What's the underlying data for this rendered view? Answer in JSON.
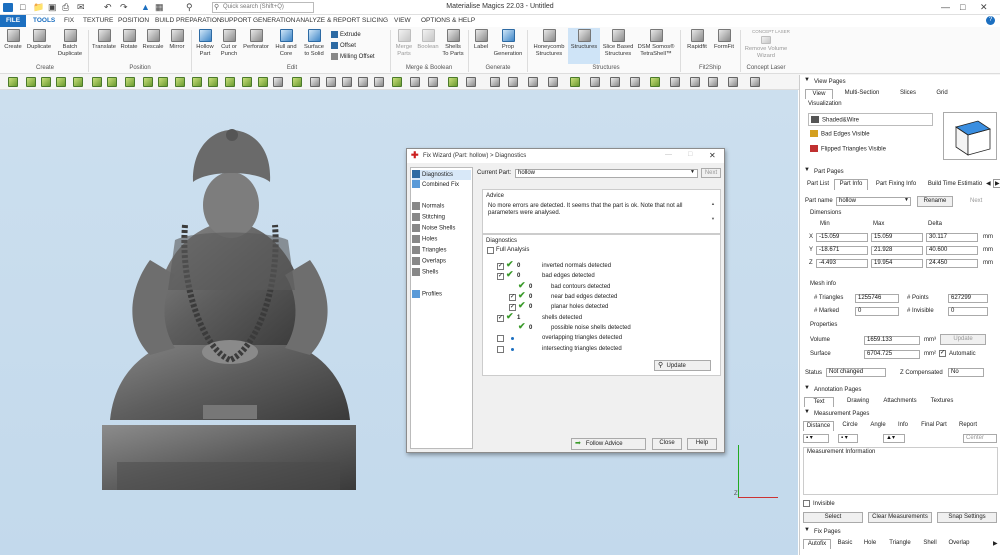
{
  "app": {
    "title": "Materialise Magics 22.03 - Untitled"
  },
  "search": {
    "placeholder": "Quick search (Shift+Q)"
  },
  "menu": [
    "FILE",
    "TOOLS",
    "FIX",
    "TEXTURE",
    "POSITION",
    "BUILD PREPARATION",
    "SUPPORT GENERATION",
    "ANALYZE & REPORT",
    "SLICING",
    "VIEW",
    "OPTIONS & HELP"
  ],
  "ribbon": {
    "create": {
      "b1": "Create",
      "b2": "Duplicate",
      "b3a": "Batch",
      "b3b": "Duplicate",
      "group": "Create"
    },
    "position": {
      "b1": "Translate",
      "b2": "Rotate",
      "b3": "Rescale",
      "b4": "Mirror",
      "group": "Position"
    },
    "edit": {
      "b1a": "Hollow",
      "b1b": "Part",
      "b2a": "Cut or",
      "b2b": "Punch",
      "b3": "Perforator",
      "b4a": "Hull and",
      "b4b": "Core",
      "b5a": "Surface",
      "b5b": "to Solid",
      "extrude": "Extrude",
      "offset": "Offset",
      "milling": "Milling Offset",
      "group": "Edit"
    },
    "merge": {
      "b1a": "Merge",
      "b1b": "Parts",
      "b2a": "Boolean",
      "b3a": "Shells",
      "b3b": "To Parts",
      "group": "Merge & Boolean"
    },
    "generate": {
      "b1": "Label",
      "b2a": "Prop",
      "b2b": "Generation",
      "group": "Generate"
    },
    "structures": {
      "b1a": "Honeycomb",
      "b1b": "Structures",
      "b2": "Structures",
      "b3a": "Slice Based",
      "b3b": "Structures",
      "b4a": "DSM Somos®",
      "b4b": "TetraShell™",
      "group": "Structures"
    },
    "fit": {
      "b1": "Rapidfit",
      "b2": "FormFit",
      "group": "Fit2Ship"
    },
    "laser": {
      "b1a": "Remove Volume",
      "b1b": "Wizard",
      "group": "Concept Laser",
      "top": "CONCEPT LASER"
    }
  },
  "right": {
    "view_pages": "View Pages",
    "view_tabs": [
      "View",
      "Multi-Section",
      "Slices",
      "Grid"
    ],
    "visualization": "Visualization",
    "vis_items": [
      "Shaded&Wire",
      "Bad Edges Visible",
      "Flipped Triangles Visible"
    ],
    "part_pages": "Part Pages",
    "part_tabs": [
      "Part List",
      "Part Info",
      "Part Fixing Info",
      "Build Time Estimatio"
    ],
    "part_name_label": "Part name",
    "part_name": "hollow",
    "rename": "Rename",
    "next": "Next",
    "dimensions": "Dimensions",
    "dim_headers": [
      "Min",
      "Max",
      "Delta"
    ],
    "dims": [
      {
        "axis": "X",
        "min": "-15.059",
        "max": "15.059",
        "delta": "30.117",
        "unit": "mm"
      },
      {
        "axis": "Y",
        "min": "-18.671",
        "max": "21.928",
        "delta": "40.600",
        "unit": "mm"
      },
      {
        "axis": "Z",
        "min": "-4.493",
        "max": "19.954",
        "delta": "24.450",
        "unit": "mm"
      }
    ],
    "mesh_info": "Mesh info",
    "triangles_label": "# Triangles",
    "triangles": "1255746",
    "points_label": "# Points",
    "points": "627299",
    "marked_label": "# Marked",
    "marked": "0",
    "invisible_label": "# Invisible",
    "invisible": "0",
    "properties": "Properties",
    "volume_label": "Volume",
    "volume": "1659.133",
    "volume_unit": "mm³",
    "update": "Update",
    "surface_label": "Surface",
    "surface": "6704.725",
    "surface_unit": "mm²",
    "automatic": "Automatic",
    "status_label": "Status",
    "status": "Not changed",
    "zcomp_label": "Z Compensated",
    "zcomp": "No",
    "annotation_pages": "Annotation Pages",
    "annotation_tabs": [
      "Text",
      "Drawing",
      "Attachments",
      "Textures"
    ],
    "measurement_pages": "Measurement Pages",
    "measure_tabs": [
      "Distance",
      "Circle",
      "Angle",
      "Info",
      "Final Part",
      "Report"
    ],
    "center": "Center",
    "measurement_info": "Measurement Information",
    "invisible_cb": "Invisible",
    "select": "Select",
    "clear": "Clear Measurements",
    "snap": "Snap Settings",
    "fix_pages": "Fix Pages",
    "fix_tabs": [
      "Autofix",
      "Basic",
      "Hole",
      "Triangle",
      "Shell",
      "Overlap"
    ]
  },
  "dialog": {
    "title": "Fix Wizard (Part: hollow) > Diagnostics",
    "nav_top": [
      "Diagnostics",
      "Combined Fix"
    ],
    "nav_mid": [
      "Normals",
      "Stitching",
      "Noise Shells",
      "Holes",
      "Triangles",
      "Overlaps",
      "Shells"
    ],
    "nav_bot": [
      "Profiles"
    ],
    "current_part_label": "Current Part:",
    "current_part": "hollow",
    "next": "Next",
    "advice_title": "Advice",
    "advice_text": "No more errors are detected. It seems that the part is ok. Note that not all parameters were analysed.",
    "diag_title": "Diagnostics",
    "full_analysis": "Full Analysis",
    "rows": [
      {
        "label": "inverted normals detected",
        "count": "0",
        "indent": 0,
        "check": true,
        "box": true
      },
      {
        "label": "bad edges detected",
        "count": "0",
        "indent": 0,
        "check": true,
        "box": true
      },
      {
        "label": "bad contours detected",
        "count": "0",
        "indent": 1,
        "check": true,
        "box": false
      },
      {
        "label": "near bad edges detected",
        "count": "0",
        "indent": 1,
        "check": true,
        "box": true
      },
      {
        "label": "planar holes detected",
        "count": "0",
        "indent": 1,
        "check": true,
        "box": true
      },
      {
        "label": "shells detected",
        "count": "1",
        "indent": 0,
        "check": true,
        "box": true
      },
      {
        "label": "possible noise shells detected",
        "count": "0",
        "indent": 1,
        "check": true,
        "box": false
      },
      {
        "label": "overlapping triangles detected",
        "count": "",
        "indent": 0,
        "check": false,
        "box": true
      },
      {
        "label": "intersecting triangles detected",
        "count": "",
        "indent": 0,
        "check": false,
        "box": true
      }
    ],
    "update": "Update",
    "follow_advice": "Follow Advice",
    "close": "Close",
    "help": "Help"
  },
  "axis": {
    "z": "Z"
  },
  "colors": {
    "accent": "#1c6fc0",
    "viewport": "#c8dcee",
    "check": "#3a9a2a"
  }
}
